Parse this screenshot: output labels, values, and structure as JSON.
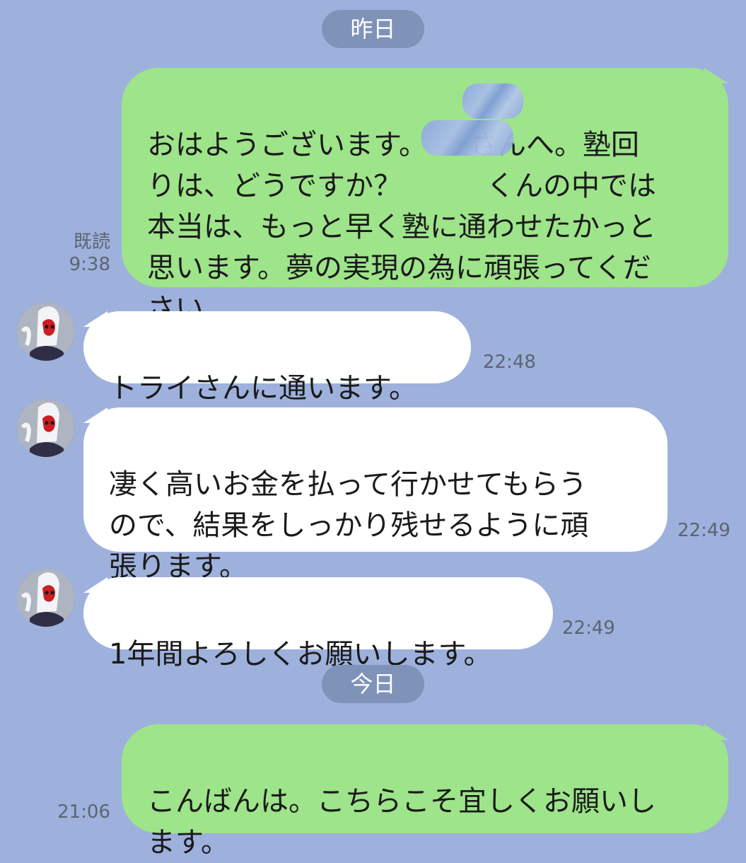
{
  "chat": {
    "dates": {
      "yesterday": "昨日",
      "today": "今日"
    },
    "messages": [
      {
        "sender": "me",
        "text": "おはようございます。　　さんへ。塾回\nりは、どうですか？　　　くんの中では\n本当は、もっと早く塾に通わせたかっと\n思います。夢の実現の為に頑張ってくだ\nさい。",
        "read": "既読",
        "time": "9:38"
      },
      {
        "sender": "them",
        "text": "トライさんに通います。",
        "time": "22:48"
      },
      {
        "sender": "them",
        "text": "凄く高いお金を払って行かせてもらう\nので、結果をしっかり残せるように頑\n張ります。",
        "time": "22:49"
      },
      {
        "sender": "them",
        "text": "1年間よろしくお願いします。",
        "time": "22:49"
      },
      {
        "sender": "me",
        "text": "こんばんは。こちらこそ宜しくお願いし\nます。",
        "time": "21:06"
      }
    ],
    "icons": {
      "avatar": "avatar-icon",
      "redaction": "blur-mask"
    },
    "colors": {
      "background": "#9eb1dc",
      "my_bubble": "#9ee48a",
      "their_bubble": "#ffffff",
      "date_pill": "#7f93b9",
      "meta_text": "#5b6472"
    }
  }
}
